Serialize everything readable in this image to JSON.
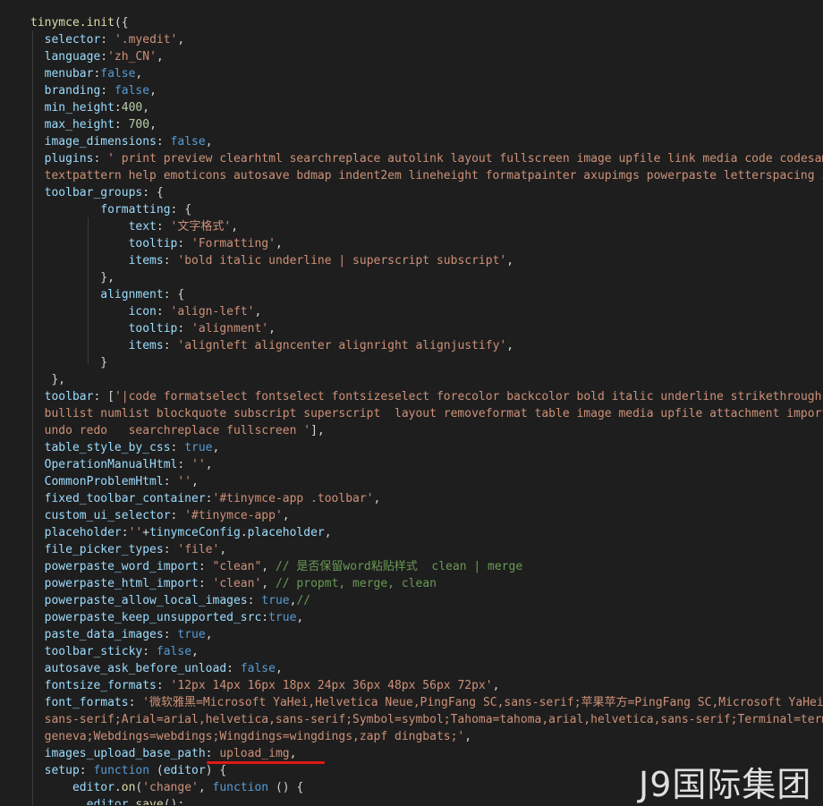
{
  "theme": {
    "background": "#1e1e1e",
    "underline_color": "#e01818"
  },
  "watermark": "J9国际集团",
  "lines": [
    [
      [
        "fn",
        "tinymce.init"
      ],
      [
        "punc",
        "({"
      ]
    ],
    [
      [
        "prop",
        "  selector"
      ],
      [
        "punc",
        ": "
      ],
      [
        "str",
        "'.myedit'"
      ],
      [
        "punc",
        ","
      ]
    ],
    [
      [
        "prop",
        "  language"
      ],
      [
        "punc",
        ":"
      ],
      [
        "str",
        "'zh_CN'"
      ],
      [
        "punc",
        ","
      ]
    ],
    [
      [
        "prop",
        "  menubar"
      ],
      [
        "punc",
        ":"
      ],
      [
        "kw",
        "false"
      ],
      [
        "punc",
        ","
      ]
    ],
    [
      [
        "prop",
        "  branding"
      ],
      [
        "punc",
        ": "
      ],
      [
        "kw",
        "false"
      ],
      [
        "punc",
        ","
      ]
    ],
    [
      [
        "prop",
        "  min_height"
      ],
      [
        "punc",
        ":"
      ],
      [
        "num",
        "400"
      ],
      [
        "punc",
        ","
      ]
    ],
    [
      [
        "prop",
        "  max_height"
      ],
      [
        "punc",
        ": "
      ],
      [
        "num",
        "700"
      ],
      [
        "punc",
        ","
      ]
    ],
    [
      [
        "prop",
        "  image_dimensions"
      ],
      [
        "punc",
        ": "
      ],
      [
        "kw",
        "false"
      ],
      [
        "punc",
        ","
      ]
    ],
    [
      [
        "prop",
        "  plugins"
      ],
      [
        "punc",
        ": "
      ],
      [
        "str",
        "' print preview clearhtml searchreplace autolink layout fullscreen image upfile link media code codesamp"
      ]
    ],
    [
      [
        "str",
        "  textpattern help emoticons autosave bdmap indent2em lineheight formatpainter axupimgs powerpaste letterspacing ima"
      ]
    ],
    [
      [
        "prop",
        "  toolbar_groups"
      ],
      [
        "punc",
        ": {"
      ]
    ],
    [
      [
        "prop",
        "          formatting"
      ],
      [
        "punc",
        ": {"
      ]
    ],
    [
      [
        "prop",
        "              text"
      ],
      [
        "punc",
        ": "
      ],
      [
        "str",
        "'文字格式'"
      ],
      [
        "punc",
        ","
      ]
    ],
    [
      [
        "prop",
        "              tooltip"
      ],
      [
        "punc",
        ": "
      ],
      [
        "str",
        "'Formatting'"
      ],
      [
        "punc",
        ","
      ]
    ],
    [
      [
        "prop",
        "              items"
      ],
      [
        "punc",
        ": "
      ],
      [
        "str",
        "'bold italic underline | superscript subscript'"
      ],
      [
        "punc",
        ","
      ]
    ],
    [
      [
        "punc",
        "          },"
      ]
    ],
    [
      [
        "prop",
        "          alignment"
      ],
      [
        "punc",
        ": {"
      ]
    ],
    [
      [
        "prop",
        "              icon"
      ],
      [
        "punc",
        ": "
      ],
      [
        "str",
        "'align-left'"
      ],
      [
        "punc",
        ","
      ]
    ],
    [
      [
        "prop",
        "              tooltip"
      ],
      [
        "punc",
        ": "
      ],
      [
        "str",
        "'alignment'"
      ],
      [
        "punc",
        ","
      ]
    ],
    [
      [
        "prop",
        "              items"
      ],
      [
        "punc",
        ": "
      ],
      [
        "str",
        "'alignleft aligncenter alignright alignjustify'"
      ],
      [
        "punc",
        ","
      ]
    ],
    [
      [
        "punc",
        "          }"
      ]
    ],
    [
      [
        "punc",
        "   },"
      ]
    ],
    [
      [
        "prop",
        "  toolbar"
      ],
      [
        "punc",
        ": ["
      ],
      [
        "str",
        "'|code formatselect fontselect fontsizeselect forecolor backcolor bold italic underline strikethrough l"
      ]
    ],
    [
      [
        "str",
        "  bullist numlist blockquote subscript superscript  layout removeformat table image media upfile attachment importw"
      ]
    ],
    [
      [
        "str",
        "  undo redo   searchreplace fullscreen '"
      ],
      [
        "punc",
        "],"
      ]
    ],
    [
      [
        "prop",
        "  table_style_by_css"
      ],
      [
        "punc",
        ": "
      ],
      [
        "kw",
        "true"
      ],
      [
        "punc",
        ","
      ]
    ],
    [
      [
        "prop",
        "  OperationManualHtml"
      ],
      [
        "punc",
        ": "
      ],
      [
        "str",
        "''"
      ],
      [
        "punc",
        ","
      ]
    ],
    [
      [
        "prop",
        "  CommonProblemHtml"
      ],
      [
        "punc",
        ": "
      ],
      [
        "str",
        "''"
      ],
      [
        "punc",
        ","
      ]
    ],
    [
      [
        "prop",
        "  fixed_toolbar_container"
      ],
      [
        "punc",
        ":"
      ],
      [
        "str",
        "'#tinymce-app .toolbar'"
      ],
      [
        "punc",
        ","
      ]
    ],
    [
      [
        "prop",
        "  custom_ui_selector"
      ],
      [
        "punc",
        ": "
      ],
      [
        "str",
        "'#tinymce-app'"
      ],
      [
        "punc",
        ","
      ]
    ],
    [
      [
        "prop",
        "  placeholder"
      ],
      [
        "punc",
        ":"
      ],
      [
        "str",
        "''"
      ],
      [
        "punc",
        "+"
      ],
      [
        "var",
        "tinymceConfig"
      ],
      [
        "punc",
        "."
      ],
      [
        "var",
        "placeholder"
      ],
      [
        "punc",
        ","
      ]
    ],
    [
      [
        "prop",
        "  file_picker_types"
      ],
      [
        "punc",
        ": "
      ],
      [
        "str",
        "'file'"
      ],
      [
        "punc",
        ","
      ]
    ],
    [
      [
        "prop",
        "  powerpaste_word_import"
      ],
      [
        "punc",
        ": "
      ],
      [
        "str",
        "\"clean\""
      ],
      [
        "punc",
        ", "
      ],
      [
        "cmt",
        "// 是否保留word粘贴样式  clean | merge"
      ]
    ],
    [
      [
        "prop",
        "  powerpaste_html_import"
      ],
      [
        "punc",
        ": "
      ],
      [
        "str",
        "'clean'"
      ],
      [
        "punc",
        ", "
      ],
      [
        "cmt",
        "// propmt, merge, clean"
      ]
    ],
    [
      [
        "prop",
        "  powerpaste_allow_local_images"
      ],
      [
        "punc",
        ": "
      ],
      [
        "kw",
        "true"
      ],
      [
        "punc",
        ","
      ],
      [
        "cmt",
        "//"
      ]
    ],
    [
      [
        "prop",
        "  powerpaste_keep_unsupported_src"
      ],
      [
        "punc",
        ":"
      ],
      [
        "kw",
        "true"
      ],
      [
        "punc",
        ","
      ]
    ],
    [
      [
        "prop",
        "  paste_data_images"
      ],
      [
        "punc",
        ": "
      ],
      [
        "kw",
        "true"
      ],
      [
        "punc",
        ","
      ]
    ],
    [
      [
        "prop",
        "  toolbar_sticky"
      ],
      [
        "punc",
        ": "
      ],
      [
        "kw",
        "false"
      ],
      [
        "punc",
        ","
      ]
    ],
    [
      [
        "prop",
        "  autosave_ask_before_unload"
      ],
      [
        "punc",
        ": "
      ],
      [
        "kw",
        "false"
      ],
      [
        "punc",
        ","
      ]
    ],
    [
      [
        "prop",
        "  fontsize_formats"
      ],
      [
        "punc",
        ": "
      ],
      [
        "str",
        "'12px 14px 16px 18px 24px 36px 48px 56px 72px'"
      ],
      [
        "punc",
        ","
      ]
    ],
    [
      [
        "prop",
        "  font_formats"
      ],
      [
        "punc",
        ": "
      ],
      [
        "str",
        "'微软雅黑=Microsoft YaHei,Helvetica Neue,PingFang SC,sans-serif;苹果苹方=PingFang SC,Microsoft YaHei,"
      ]
    ],
    [
      [
        "str",
        "  sans-serif;Arial=arial,helvetica,sans-serif;Symbol=symbol;Tahoma=tahoma,arial,helvetica,sans-serif;Terminal=termi"
      ]
    ],
    [
      [
        "str",
        "  geneva;Webdings=webdings;Wingdings=wingdings,zapf dingbats;'"
      ],
      [
        "punc",
        ","
      ]
    ],
    [
      [
        "prop",
        "  images_upload_base_path"
      ],
      [
        "punc",
        ": "
      ],
      [
        "str",
        "upload_img"
      ],
      [
        "punc",
        ","
      ]
    ],
    [
      [
        "prop",
        "  setup"
      ],
      [
        "punc",
        ": "
      ],
      [
        "kw",
        "function"
      ],
      [
        "punc",
        " ("
      ],
      [
        "var",
        "editor"
      ],
      [
        "punc",
        ") {"
      ]
    ],
    [
      [
        "var",
        "      editor"
      ],
      [
        "punc",
        "."
      ],
      [
        "fn",
        "on"
      ],
      [
        "punc",
        "("
      ],
      [
        "str",
        "'change'"
      ],
      [
        "punc",
        ", "
      ],
      [
        "kw",
        "function"
      ],
      [
        "punc",
        " () {"
      ]
    ],
    [
      [
        "var",
        "        editor"
      ],
      [
        "punc",
        "."
      ],
      [
        "fn",
        "save"
      ],
      [
        "punc",
        "();"
      ]
    ]
  ]
}
